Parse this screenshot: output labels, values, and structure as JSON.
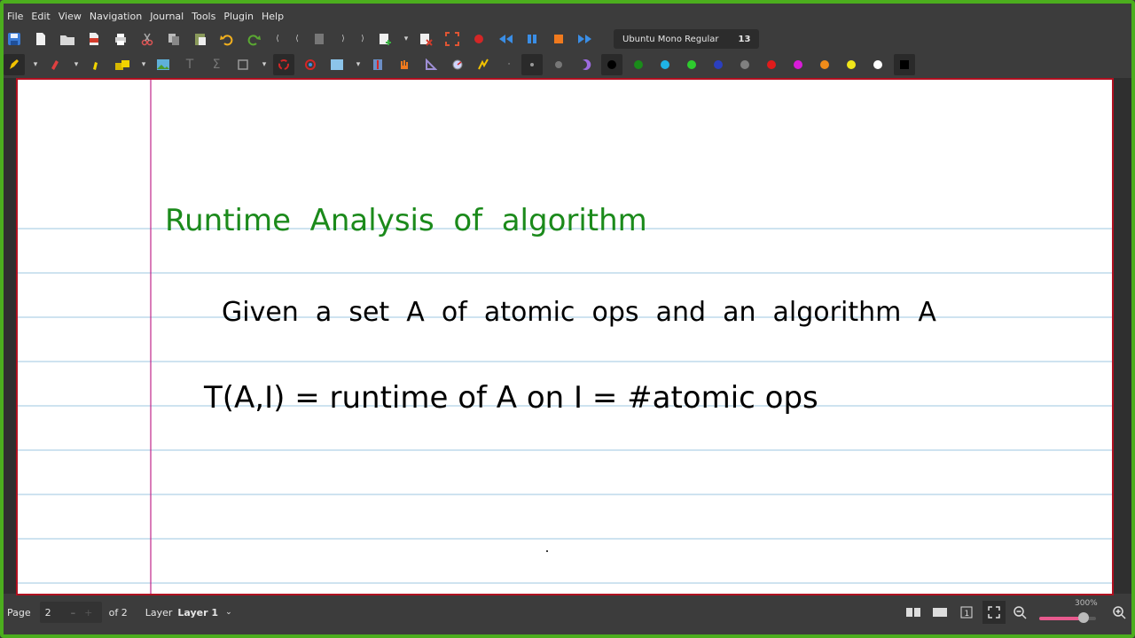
{
  "menu": [
    "File",
    "Edit",
    "View",
    "Navigation",
    "Journal",
    "Tools",
    "Plugin",
    "Help"
  ],
  "toolbar1": {
    "icons": [
      "save-icon",
      "new-page-icon",
      "open-icon",
      "export-pdf-icon",
      "print-icon",
      "cut-icon",
      "copy-icon",
      "paste-icon",
      "undo-icon",
      "redo-icon",
      "first-page-icon",
      "previous-page-icon",
      "goto-page-icon",
      "next-page-icon",
      "last-page-icon",
      "new-page-after-icon",
      "dropdown-icon",
      "delete-page-icon",
      "fullscreen-icon",
      "record-icon",
      "rewind-icon",
      "pause-icon",
      "stop-icon",
      "fast-forward-icon"
    ],
    "font_name": "Ubuntu Mono Regular",
    "font_size": "13"
  },
  "toolbar2": {
    "color_palette": [
      "#000000",
      "#1a8c1a",
      "#1fb3e6",
      "#2ecc2e",
      "#2b3fbf",
      "#808080",
      "#e01b1b",
      "#d81bd8",
      "#f08c1a",
      "#f0e61a",
      "#ffffff",
      "#000000"
    ]
  },
  "page_content": {
    "title": "Runtime  Analysis  of  algorithm",
    "line1": "Given  a  set  A  of  atomic  ops  and  an  algorithm  A",
    "line2": "T(A,I) = runtime of A on I = #atomic ops",
    "title_color": "#1b8a1b",
    "text_color": "#000000",
    "rule_color": "#9cc7e0",
    "margin_color": "#c0268a"
  },
  "status": {
    "page_label": "Page",
    "page_value": "2",
    "of_label": "of 2",
    "layer_label": "Layer",
    "layer_value": "Layer 1",
    "zoom": "300%",
    "zoom_fraction": 0.78
  }
}
